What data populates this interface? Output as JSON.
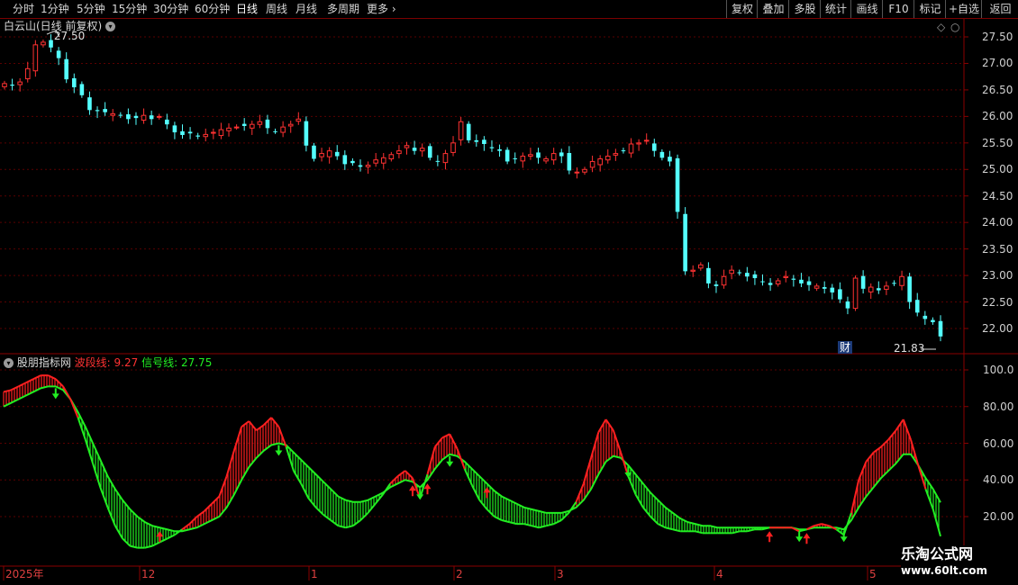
{
  "toolbar": {
    "periods": [
      "分时",
      "1分钟",
      "5分钟",
      "15分钟",
      "30分钟",
      "60分钟",
      "日线",
      "周线",
      "月线",
      "多周期",
      "更多"
    ],
    "active": "日线",
    "more_arrow": "›",
    "right_buttons": [
      "复权",
      "叠加",
      "多股",
      "统计",
      "画线",
      "F10",
      "标记",
      "+自选",
      "返回"
    ]
  },
  "main_panel": {
    "title": "白云山(日线 前复权)",
    "price_labels": [
      "27.50",
      "27.00",
      "26.50",
      "26.00",
      "25.50",
      "25.00",
      "24.50",
      "24.00",
      "23.50",
      "23.00",
      "22.50",
      "22.00"
    ],
    "high_marker": "27.50",
    "low_marker": "21.83",
    "finance_badge": "财"
  },
  "indicator_panel": {
    "name": "股朋指标网",
    "wave_label": "波段线:",
    "wave_value": "9.27",
    "signal_label": "信号线:",
    "signal_value": "27.75",
    "scale_labels": [
      "100.0",
      "80.00",
      "60.00",
      "40.00",
      "20.00"
    ]
  },
  "date_axis": [
    "2025年",
    "12",
    "1",
    "2",
    "3",
    "4",
    "5"
  ],
  "watermark": {
    "line1": "乐淘公式网",
    "line2": "www.60lt.com"
  },
  "colors": {
    "up": "#ff3232",
    "down": "#54ffff",
    "bg": "#000000",
    "grid": "#5a0000",
    "wave": "#ff2020",
    "signal": "#22ee22"
  },
  "chart_data": {
    "type": "candlestick",
    "close": [
      26.62,
      26.58,
      26.65,
      26.9,
      27.35,
      27.4,
      27.3,
      27.1,
      26.7,
      26.55,
      26.4,
      26.12,
      26.1,
      26.08,
      26.05,
      26.02,
      25.95,
      25.97,
      26.02,
      25.95,
      26.0,
      25.85,
      25.7,
      25.65,
      25.68,
      25.62,
      25.66,
      25.7,
      25.75,
      25.78,
      25.8,
      25.82,
      25.85,
      25.9,
      25.78,
      25.72,
      25.8,
      25.85,
      25.95,
      25.45,
      25.2,
      25.3,
      25.35,
      25.25,
      25.1,
      25.12,
      25.05,
      25.08,
      25.18,
      25.22,
      25.28,
      25.35,
      25.45,
      25.35,
      25.4,
      25.22,
      25.15,
      25.3,
      25.5,
      25.9,
      25.55,
      25.52,
      25.48,
      25.4,
      25.35,
      25.15,
      25.2,
      25.25,
      25.28,
      25.22,
      25.2,
      25.3,
      25.25,
      24.98,
      24.95,
      25.0,
      25.15,
      25.2,
      25.25,
      25.3,
      25.35,
      25.48,
      25.5,
      25.55,
      25.35,
      25.22,
      25.15,
      24.2,
      23.08,
      23.1,
      23.2,
      22.85,
      22.8,
      22.98,
      23.1,
      23.05,
      22.98,
      22.95,
      22.88,
      22.82,
      22.9,
      22.98,
      22.92,
      22.85,
      22.82,
      22.8,
      22.75,
      22.68,
      22.55,
      22.38,
      22.95,
      22.75,
      22.78,
      22.72,
      22.8,
      22.85,
      22.98,
      22.5,
      22.3,
      22.18,
      22.12,
      21.85
    ],
    "wave_line": [
      88,
      89,
      91,
      93,
      95,
      97,
      97,
      95,
      91,
      84,
      74,
      62,
      49,
      36,
      25,
      15,
      8,
      4,
      3,
      3,
      4,
      6,
      8,
      10,
      13,
      16,
      20,
      23,
      27,
      31,
      42,
      56,
      69,
      72,
      67,
      70,
      74,
      69,
      58,
      45,
      38,
      30,
      25,
      21,
      18,
      15,
      14,
      15,
      18,
      22,
      27,
      32,
      38,
      42,
      45,
      41,
      30,
      43,
      58,
      63,
      65,
      57,
      46,
      37,
      29,
      24,
      20,
      18,
      17,
      16,
      16,
      15,
      14,
      15,
      16,
      18,
      22,
      28,
      38,
      52,
      66,
      73,
      67,
      55,
      42,
      32,
      25,
      20,
      16,
      14,
      13,
      12,
      12,
      12,
      11,
      11,
      11,
      11,
      11,
      12,
      12,
      13,
      13,
      14,
      14,
      14,
      14,
      12,
      13,
      15,
      16,
      15,
      13,
      10,
      22,
      40,
      50,
      55,
      58,
      62,
      67,
      73,
      62,
      48,
      35,
      24,
      9.27
    ],
    "signal_line": [
      80,
      82,
      84,
      86,
      88,
      90,
      91,
      91,
      89,
      84,
      77,
      69,
      60,
      51,
      42,
      35,
      29,
      24,
      20,
      17,
      15,
      14,
      13,
      12,
      12,
      13,
      14,
      16,
      18,
      20,
      25,
      32,
      40,
      47,
      52,
      56,
      59,
      60,
      59,
      55,
      51,
      47,
      43,
      39,
      35,
      31,
      29,
      28,
      28,
      29,
      31,
      33,
      36,
      38,
      40,
      39,
      36,
      40,
      46,
      51,
      54,
      53,
      50,
      46,
      42,
      38,
      34,
      31,
      29,
      27,
      25,
      24,
      23,
      22,
      22,
      22,
      23,
      25,
      29,
      35,
      43,
      50,
      53,
      52,
      48,
      43,
      38,
      33,
      29,
      25,
      22,
      19,
      17,
      16,
      15,
      15,
      14,
      14,
      14,
      14,
      14,
      14,
      14,
      14,
      14,
      14,
      14,
      13,
      13,
      14,
      14,
      14,
      14,
      13,
      18,
      25,
      31,
      36,
      41,
      45,
      49,
      54,
      54,
      48,
      41,
      35,
      27.75
    ],
    "buy_signals_index": [
      21,
      55,
      57,
      65,
      103,
      108
    ],
    "sell_signals_index": [
      7,
      37,
      56,
      60,
      84,
      107,
      113
    ]
  }
}
